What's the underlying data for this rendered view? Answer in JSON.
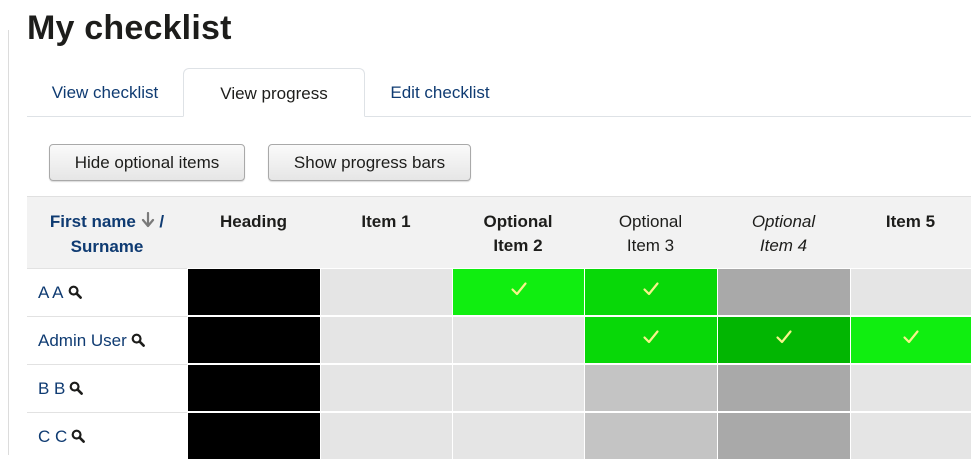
{
  "page": {
    "title": "My checklist"
  },
  "tabs": [
    {
      "label": "View checklist",
      "active": false
    },
    {
      "label": "View progress",
      "active": true
    },
    {
      "label": "Edit checklist",
      "active": false
    }
  ],
  "toolbar": {
    "hide_optional_label": "Hide optional items",
    "show_progress_label": "Show progress bars"
  },
  "table": {
    "name_header": {
      "first_name": "First name",
      "separator": "/",
      "surname": "Surname"
    },
    "columns": [
      {
        "line1": "Heading",
        "line2": "",
        "style": "bold"
      },
      {
        "line1": "Item 1",
        "line2": "",
        "style": "bold"
      },
      {
        "line1": "Optional",
        "line2": "Item 2",
        "style": "bold"
      },
      {
        "line1": "Optional",
        "line2": "Item 3",
        "style": "normal"
      },
      {
        "line1": "Optional",
        "line2": "Item 4",
        "style": "italic"
      },
      {
        "line1": "Item 5",
        "line2": "",
        "style": "bold"
      }
    ],
    "rows": [
      {
        "name": "A A",
        "cells": [
          {
            "state": "heading",
            "checked": false
          },
          {
            "state": "empty",
            "checked": false
          },
          {
            "state": "checked",
            "checked": true
          },
          {
            "state": "checked-bright",
            "checked": true
          },
          {
            "state": "optional-empty",
            "checked": false
          },
          {
            "state": "empty",
            "checked": false
          }
        ]
      },
      {
        "name": "Admin User",
        "cells": [
          {
            "state": "heading",
            "checked": false
          },
          {
            "state": "empty",
            "checked": false
          },
          {
            "state": "empty",
            "checked": false
          },
          {
            "state": "checked-bright",
            "checked": true
          },
          {
            "state": "checked-dark",
            "checked": true
          },
          {
            "state": "checked",
            "checked": true
          }
        ]
      },
      {
        "name": "B B",
        "cells": [
          {
            "state": "heading",
            "checked": false
          },
          {
            "state": "empty",
            "checked": false
          },
          {
            "state": "empty",
            "checked": false
          },
          {
            "state": "optional-light",
            "checked": false
          },
          {
            "state": "optional-empty",
            "checked": false
          },
          {
            "state": "empty",
            "checked": false
          }
        ]
      },
      {
        "name": "C C",
        "cells": [
          {
            "state": "heading",
            "checked": false
          },
          {
            "state": "empty",
            "checked": false
          },
          {
            "state": "empty",
            "checked": false
          },
          {
            "state": "optional-light",
            "checked": false
          },
          {
            "state": "optional-empty",
            "checked": false
          },
          {
            "state": "empty",
            "checked": false
          }
        ]
      }
    ]
  },
  "colors": {
    "link": "#0f3b72",
    "heading_cell": "#000000",
    "empty_cell": "#e5e5e5",
    "optional_light_cell": "#c4c4c4",
    "optional_empty_cell": "#a9a9a9",
    "checked_cell": "#10ee10",
    "checked_bright_cell": "#08d808",
    "checked_dark_cell": "#02b602",
    "check_mark": "#f7f48a"
  },
  "icons": {
    "sort": "arrow-down-icon",
    "search": "search-icon",
    "check": "check-icon"
  }
}
